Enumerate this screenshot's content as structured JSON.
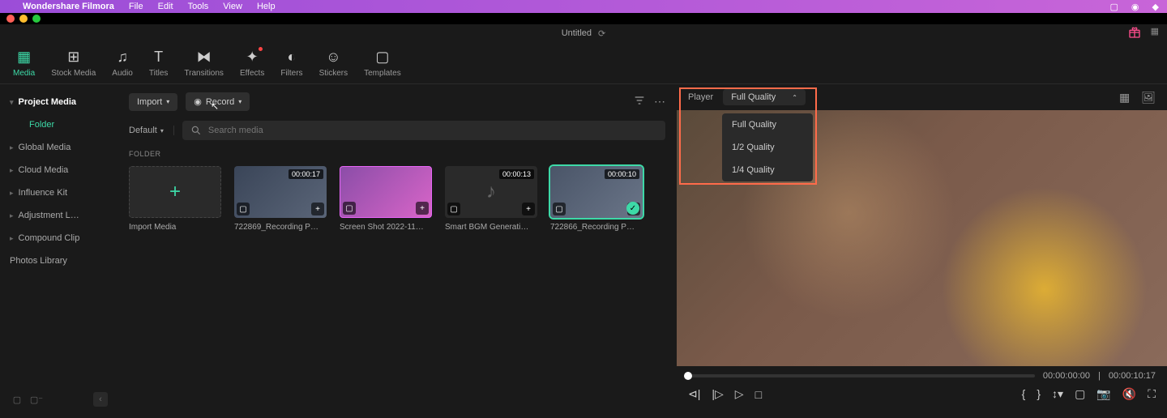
{
  "menubar": {
    "app_name": "Wondershare Filmora",
    "items": [
      "File",
      "Edit",
      "Tools",
      "View",
      "Help"
    ]
  },
  "doc_title": "Untitled",
  "toolbar": {
    "tabs": [
      {
        "label": "Media",
        "active": true
      },
      {
        "label": "Stock Media"
      },
      {
        "label": "Audio"
      },
      {
        "label": "Titles"
      },
      {
        "label": "Transitions"
      },
      {
        "label": "Effects",
        "badge": true
      },
      {
        "label": "Filters"
      },
      {
        "label": "Stickers"
      },
      {
        "label": "Templates"
      }
    ]
  },
  "sidebar": {
    "items": [
      {
        "label": "Project Media",
        "expanded": true
      },
      {
        "label": "Folder",
        "sub": true,
        "active": true
      },
      {
        "label": "Global Media"
      },
      {
        "label": "Cloud Media"
      },
      {
        "label": "Influence Kit"
      },
      {
        "label": "Adjustment L…"
      },
      {
        "label": "Compound Clip"
      },
      {
        "label": "Photos Library"
      }
    ]
  },
  "media_controls": {
    "import_label": "Import",
    "record_label": "Record"
  },
  "search": {
    "default_label": "Default",
    "placeholder": "Search media"
  },
  "folder_label": "FOLDER",
  "media_items": [
    {
      "type": "import",
      "label": "Import Media"
    },
    {
      "type": "clip",
      "duration": "00:00:17",
      "label": "722869_Recording P…",
      "thumb_class": "thumb-recording"
    },
    {
      "type": "clip",
      "duration": "",
      "label": "Screen Shot 2022-11…",
      "thumb_class": "thumb-screenshot"
    },
    {
      "type": "bgm",
      "duration": "00:00:13",
      "label": "Smart BGM Generati…"
    },
    {
      "type": "clip",
      "duration": "00:00:10",
      "label": "722866_Recording P…",
      "thumb_class": "thumb-selected",
      "selected": true
    }
  ],
  "preview": {
    "player_label": "Player",
    "quality_selected": "Full Quality",
    "quality_options": [
      "Full Quality",
      "1/2 Quality",
      "1/4 Quality"
    ],
    "time_current": "00:00:00:00",
    "time_total": "00:00:10:17"
  }
}
